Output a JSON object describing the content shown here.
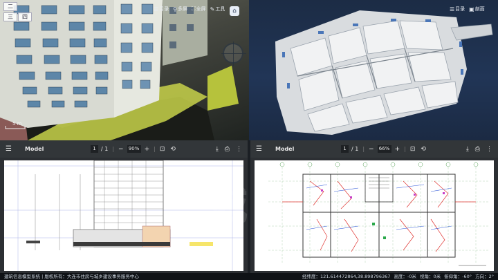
{
  "viewer_tl": {
    "view_buttons": [
      "二",
      "三",
      "四"
    ],
    "menu": [
      {
        "glyph": "☰",
        "label": "目录"
      },
      {
        "glyph": "⚲",
        "label": "多屏"
      },
      {
        "glyph": "⛶",
        "label": "全屏"
      },
      {
        "glyph": "✎",
        "label": "工具"
      }
    ],
    "home_glyph": "⌂",
    "scale_label": "5 m"
  },
  "viewer_tr": {
    "menu": [
      {
        "glyph": "☰",
        "label": "目录"
      },
      {
        "glyph": "▣",
        "label": "剖面"
      }
    ]
  },
  "pdf_left": {
    "title": "Model",
    "page_current": "1",
    "page_total": "/ 1",
    "zoom": "90%",
    "minus": "−",
    "plus": "+"
  },
  "pdf_right": {
    "title": "Model",
    "page_current": "1",
    "page_total": "/ 1",
    "zoom": "66%",
    "minus": "−",
    "plus": "+"
  },
  "icons": {
    "menu": "☰",
    "fit": "⊡",
    "rotate": "⟲",
    "download": "⤓",
    "print": "⎙",
    "more": "⋮"
  },
  "footer": {
    "left": "建筑信息模型系统 | 版权所有：大连市住房与城乡建设事务服务中心",
    "right": "经纬度：121.614472864,38.898796367   高度：-0米   视角：0米   俯仰角：-60°   方向：2°"
  },
  "watermark": "城 信"
}
